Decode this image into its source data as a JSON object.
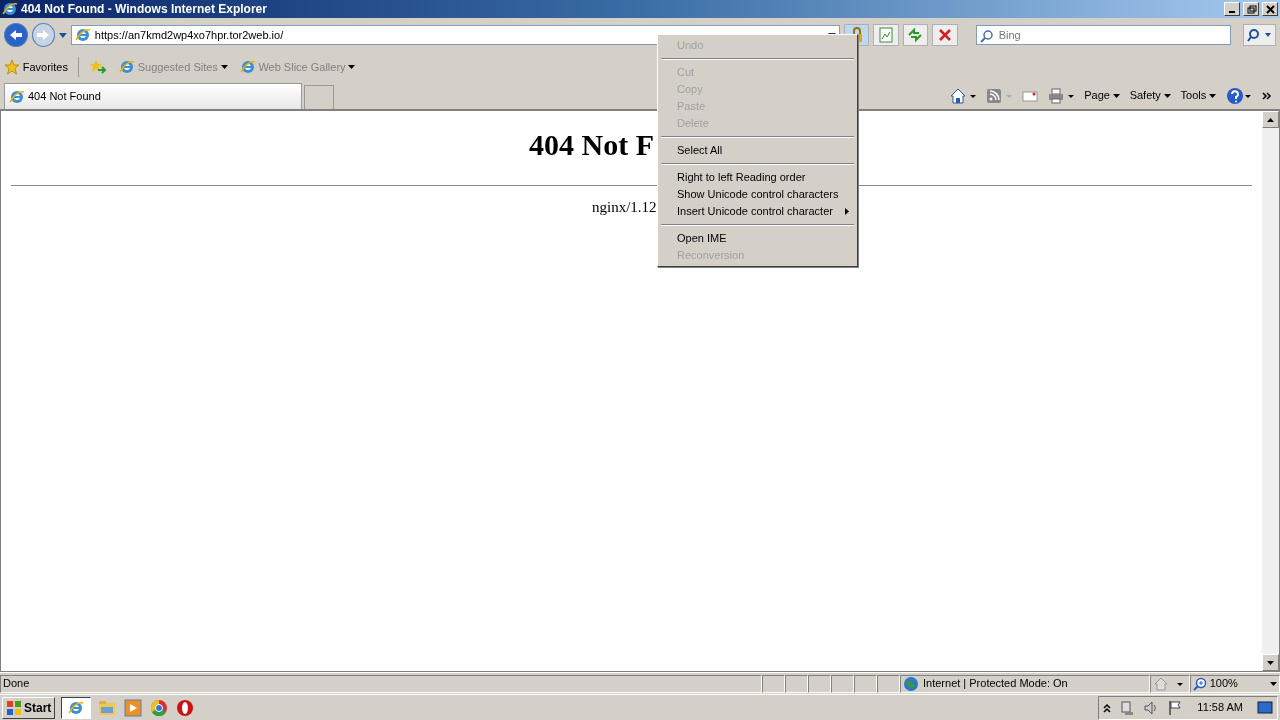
{
  "window": {
    "title": "404 Not Found - Windows Internet Explorer"
  },
  "address_bar": {
    "url": "https://an7kmd2wp4xo7hpr.tor2web.io/"
  },
  "search": {
    "placeholder": "Bing"
  },
  "favorites_bar": {
    "label": "Favorites",
    "items": [
      {
        "label": "Suggested Sites",
        "disabled": true
      },
      {
        "label": "Web Slice Gallery",
        "disabled": true
      }
    ]
  },
  "tabs": [
    {
      "label": "404 Not Found",
      "selected": true
    },
    {
      "selected": false
    }
  ],
  "command_bar": [
    "Page",
    "Safety",
    "Tools"
  ],
  "page": {
    "heading": "404 Not F",
    "footer": "nginx/1.12"
  },
  "context_menu": [
    {
      "kind": "item",
      "label": "Undo",
      "disabled": true
    },
    {
      "kind": "separator"
    },
    {
      "kind": "item",
      "label": "Cut",
      "disabled": true
    },
    {
      "kind": "item",
      "label": "Copy",
      "disabled": true
    },
    {
      "kind": "item",
      "label": "Paste",
      "disabled": true
    },
    {
      "kind": "item",
      "label": "Delete",
      "disabled": true
    },
    {
      "kind": "separator"
    },
    {
      "kind": "item",
      "label": "Select All",
      "disabled": false
    },
    {
      "kind": "separator"
    },
    {
      "kind": "item",
      "label": "Right to left Reading order",
      "disabled": false
    },
    {
      "kind": "item",
      "label": "Show Unicode control characters",
      "disabled": false
    },
    {
      "kind": "submenu",
      "label": "Insert Unicode control character",
      "disabled": false
    },
    {
      "kind": "separator"
    },
    {
      "kind": "item",
      "label": "Open IME",
      "disabled": false
    },
    {
      "kind": "item",
      "label": "Reconversion",
      "disabled": true
    }
  ],
  "status_bar": {
    "text": "Done",
    "zone": "Internet | Protected Mode: On",
    "zoom": "100%"
  },
  "taskbar": {
    "start": "Start",
    "clock": "11:58 AM"
  }
}
